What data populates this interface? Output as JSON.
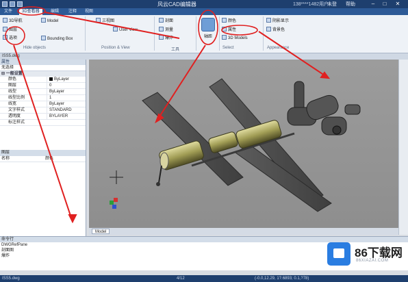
{
  "window": {
    "title": "风云CAD编辑器",
    "account": "138****1482用户",
    "login_label": "未登",
    "help_label": "帮助",
    "colors": {
      "titlebar": "#1e3f6e",
      "tabbar": "#2d5a96",
      "annotation": "#e02020",
      "watermark": "#2a7de1"
    }
  },
  "tabs": [
    {
      "label": "文件"
    },
    {
      "label": "3D查看器"
    },
    {
      "label": "编辑"
    },
    {
      "label": "注释"
    },
    {
      "label": "视图"
    }
  ],
  "ribbon": {
    "buttons": [
      {
        "label": "3D导航"
      },
      {
        "label": "图层"
      },
      {
        "label": "选项"
      },
      {
        "label": "Model"
      },
      {
        "label": "三视图"
      },
      {
        "label": "User View"
      },
      {
        "label": "Bounding Box"
      },
      {
        "label": "剖面"
      },
      {
        "label": "测量"
      },
      {
        "label": "爆炸"
      },
      {
        "label": "轴距"
      },
      {
        "label": "颜色"
      },
      {
        "label": "属性"
      },
      {
        "label": "3D Models"
      },
      {
        "label": "阴影显示"
      },
      {
        "label": "背景色"
      }
    ],
    "groups": [
      {
        "label": "Hide objects"
      },
      {
        "label": "Position & View"
      },
      {
        "label": "工具"
      },
      {
        "label": "Select"
      },
      {
        "label": "Appearance"
      }
    ]
  },
  "document": {
    "filename": "ISS5.dwg"
  },
  "properties": {
    "header": "属性",
    "selector": "无选择",
    "section": "一般设置",
    "rows": [
      {
        "key": "颜色",
        "value": "ByLayer"
      },
      {
        "key": "图层",
        "value": "0"
      },
      {
        "key": "线型",
        "value": "ByLayer"
      },
      {
        "key": "线型比例",
        "value": "1"
      },
      {
        "key": "线宽",
        "value": "ByLayer"
      },
      {
        "key": "文字样式",
        "value": "STANDARD"
      },
      {
        "key": "透明度",
        "value": "BYLAYER"
      },
      {
        "key": "标注样式",
        "value": ""
      }
    ]
  },
  "layers": {
    "header": "图层",
    "columns": [
      "名称",
      "颜色"
    ]
  },
  "viewport": {
    "tab_label": "Model"
  },
  "command": {
    "header": "命令行",
    "lines": [
      "DWGRefPane",
      "剖面图",
      "爆炸"
    ]
  },
  "statusbar": {
    "file": "ISS5.dwg",
    "page": "4/12",
    "coords": "(-0.0,12.29, 1?.6893; 0.1,?78)"
  },
  "watermark": {
    "brand": "86下载网",
    "url": "86XIAZAI.COM"
  }
}
